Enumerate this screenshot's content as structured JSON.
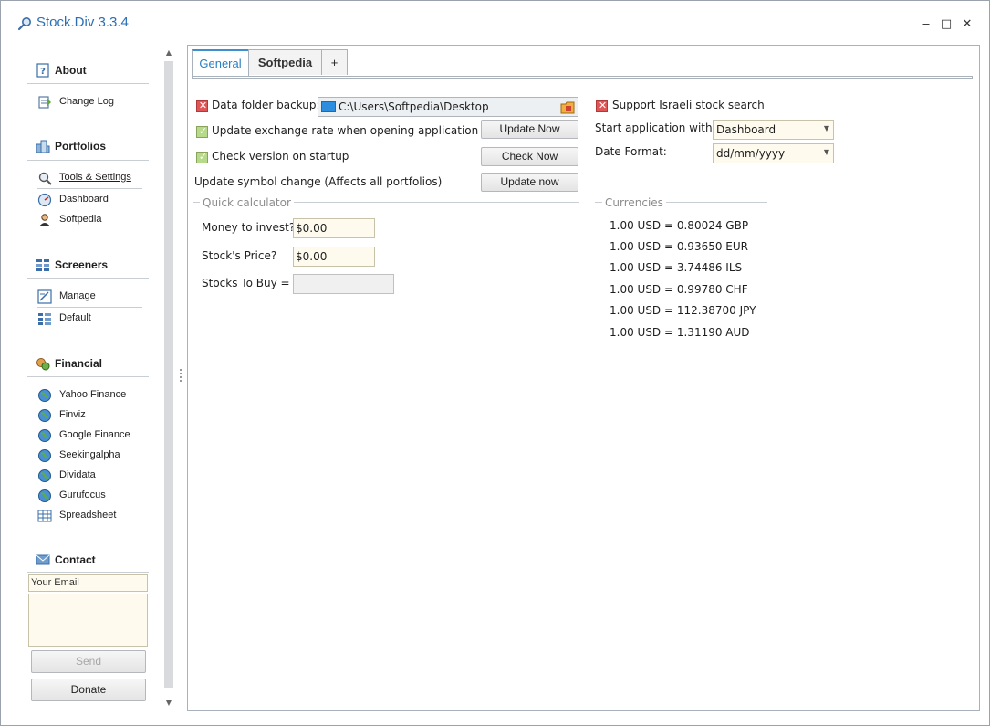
{
  "window": {
    "title": "Stock.Div 3.3.4",
    "minimize_glyph": "‒",
    "maximize_glyph": "□",
    "close_glyph": "✕"
  },
  "sidebar": {
    "about": {
      "title": "About",
      "items": [
        {
          "label": "Change Log",
          "icon": "changelog-icon"
        }
      ]
    },
    "portfolios": {
      "title": "Portfolios",
      "items": [
        {
          "label": "Tools & Settings",
          "icon": "tools-icon"
        },
        {
          "label": "Dashboard",
          "icon": "dashboard-icon"
        },
        {
          "label": "Softpedia",
          "icon": "user-icon"
        }
      ]
    },
    "screeners": {
      "title": "Screeners",
      "items": [
        {
          "label": "Manage",
          "icon": "manage-icon"
        },
        {
          "label": "Default",
          "icon": "grid-icon"
        }
      ]
    },
    "financial": {
      "title": "Financial",
      "items": [
        {
          "label": "Yahoo Finance",
          "icon": "globe-icon"
        },
        {
          "label": "Finviz",
          "icon": "globe-icon"
        },
        {
          "label": "Google Finance",
          "icon": "globe-icon"
        },
        {
          "label": "Seekingalpha",
          "icon": "globe-icon"
        },
        {
          "label": "Dividata",
          "icon": "globe-icon"
        },
        {
          "label": "Gurufocus",
          "icon": "globe-icon"
        },
        {
          "label": "Spreadsheet",
          "icon": "spreadsheet-icon"
        }
      ]
    },
    "contact": {
      "title": "Contact",
      "email_value": "Your Email",
      "send_label": "Send",
      "donate_label": "Donate"
    }
  },
  "tabs": [
    {
      "label": "General",
      "active": true
    },
    {
      "label": "Softpedia",
      "active": false
    },
    {
      "label": "+",
      "active": false
    }
  ],
  "general": {
    "data_folder_label": "Data folder backup:",
    "data_folder_path": "C:\\Users\\Softpedia\\Desktop",
    "update_exchange_label": "Update exchange rate when opening application",
    "update_exchange_button": "Update Now",
    "check_version_label": "Check version on startup",
    "check_version_button": "Check Now",
    "update_symbol_label": "Update symbol change (Affects all portfolios)",
    "update_symbol_button": "Update now",
    "support_israeli_label": "Support Israeli stock search",
    "start_app_label": "Start application with",
    "start_app_value": "Dashboard",
    "date_format_label": "Date Format:",
    "date_format_value": "dd/mm/yyyy"
  },
  "calculator": {
    "title": "Quick calculator",
    "money_label": "Money to invest?",
    "money_value": "$0.00",
    "price_label": "Stock's Price?",
    "price_value": "$0.00",
    "buy_label": "Stocks To Buy =",
    "buy_value": ""
  },
  "currencies": {
    "title": "Currencies",
    "rows": [
      "1.00 USD = 0.80024 GBP",
      "1.00 USD = 0.93650 EUR",
      "1.00 USD = 3.74486 ILS",
      "1.00 USD = 0.99780 CHF",
      "1.00 USD = 112.38700 JPY",
      "1.00 USD = 1.31190 AUD"
    ]
  },
  "colors": {
    "accent": "#2a7fc0",
    "title_text": "#2a6fb5",
    "input_bg": "#fefbee"
  }
}
